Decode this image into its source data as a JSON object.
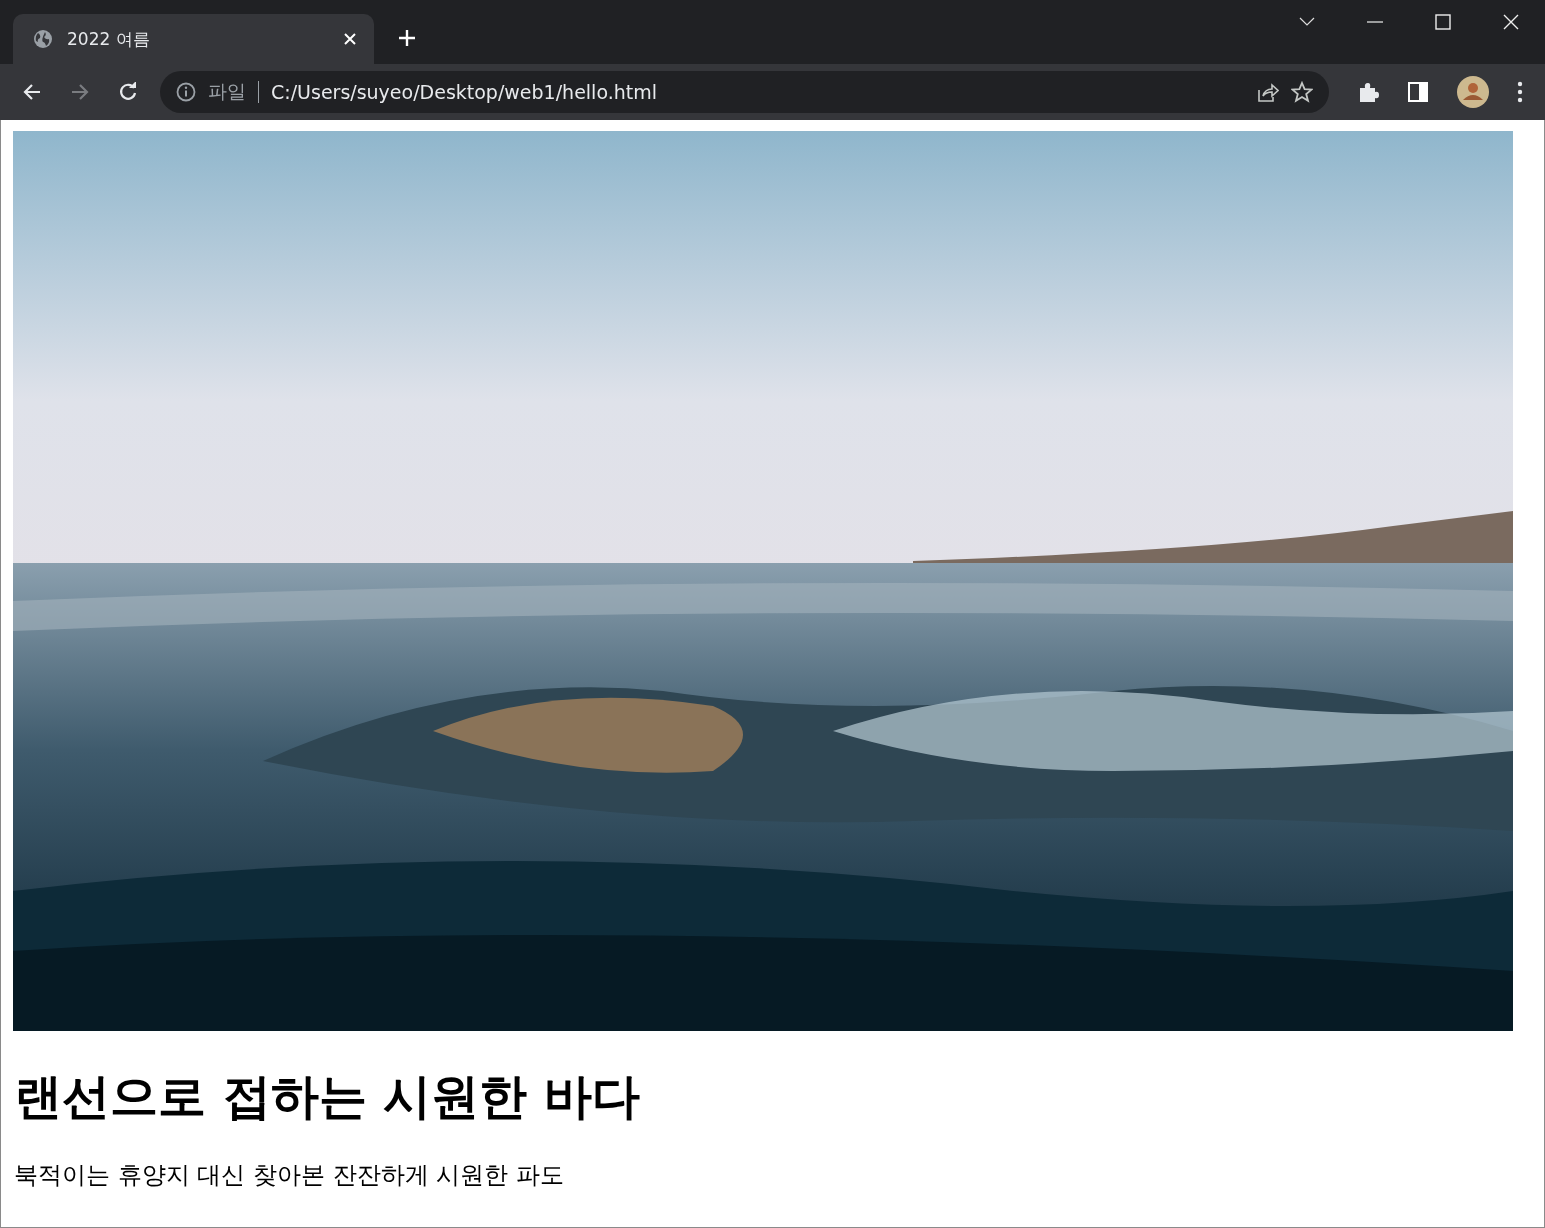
{
  "tabs": [
    {
      "title": "2022 여름",
      "selected": true
    }
  ],
  "address_bar": {
    "scheme_label": "파일",
    "url": "C:/Users/suyeo/Desktop/web1/hello.html"
  },
  "page": {
    "heading": "랜선으로 접하는 시원한 바다",
    "paragraph": "북적이는 휴양지 대신 찾아본 잔잔하게 시원한 파도"
  }
}
